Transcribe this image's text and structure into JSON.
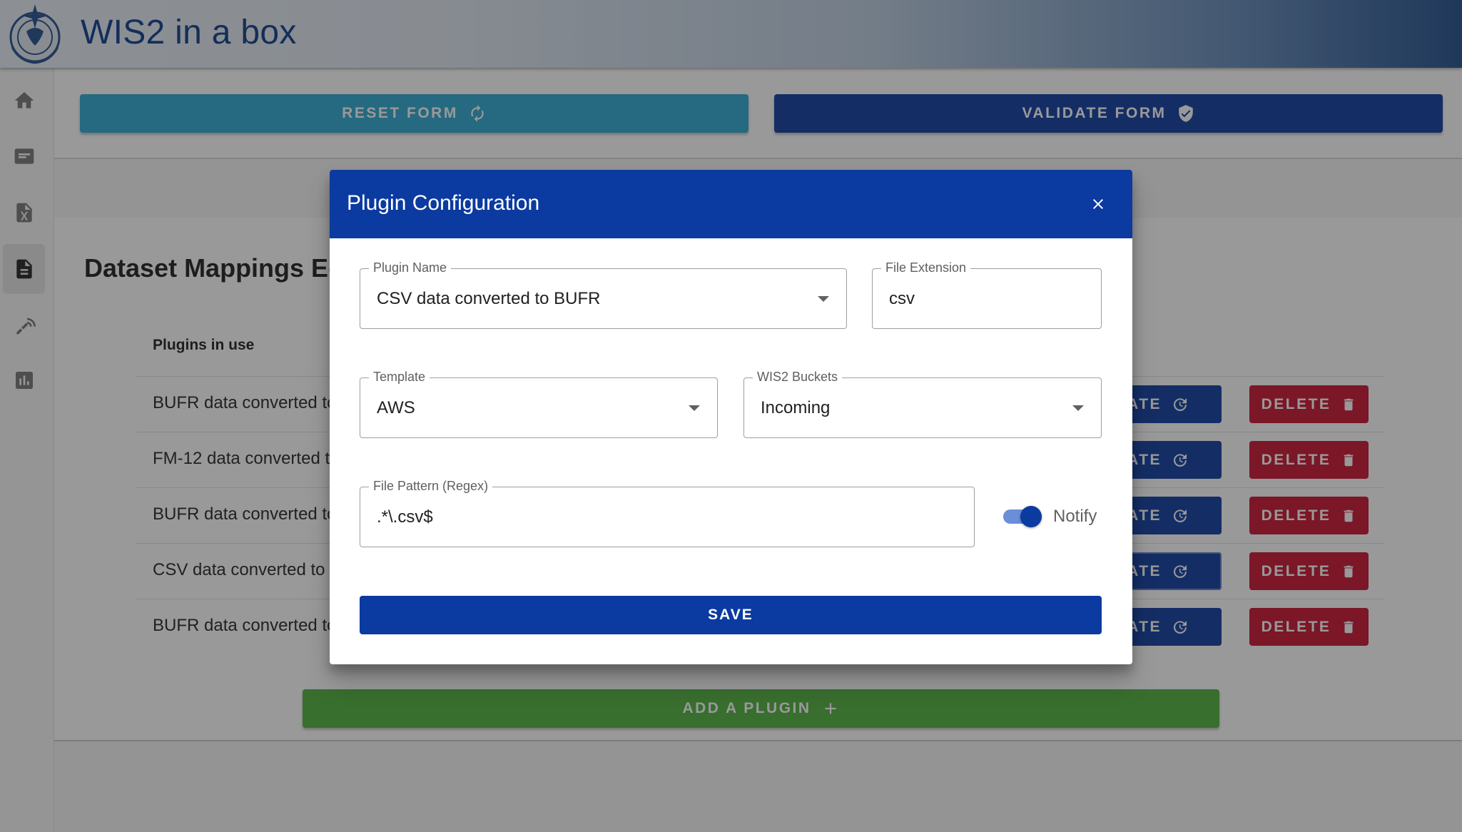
{
  "app": {
    "title": "WIS2 in a box"
  },
  "toolbar": {
    "reset_label": "RESET FORM",
    "validate_label": "VALIDATE FORM"
  },
  "sidebar": {
    "items": [
      {
        "icon": "home-icon"
      },
      {
        "icon": "list-icon"
      },
      {
        "icon": "excel-file-icon"
      },
      {
        "icon": "document-icon",
        "active": true
      },
      {
        "icon": "antenna-icon"
      },
      {
        "icon": "bar-chart-icon"
      }
    ]
  },
  "main": {
    "title": "Dataset Mappings Ed",
    "table_header": "Plugins in use",
    "rows": [
      {
        "label": "BUFR data converted to",
        "update": "PDATE",
        "delete": "DELETE"
      },
      {
        "label": "FM-12 data converted t",
        "update": "PDATE",
        "delete": "DELETE"
      },
      {
        "label": "BUFR data converted to",
        "update": "PDATE",
        "delete": "DELETE"
      },
      {
        "label": "CSV data converted to I",
        "update": "PDATE",
        "delete": "DELETE"
      },
      {
        "label": "BUFR data converted to",
        "update": "PDATE",
        "delete": "DELETE"
      }
    ],
    "add_label": "ADD A PLUGIN"
  },
  "dialog": {
    "title": "Plugin Configuration",
    "plugin_name": {
      "label": "Plugin Name",
      "value": "CSV data converted to BUFR"
    },
    "file_extension": {
      "label": "File Extension",
      "value": "csv"
    },
    "template": {
      "label": "Template",
      "value": "AWS"
    },
    "buckets": {
      "label": "WIS2 Buckets",
      "value": "Incoming"
    },
    "file_pattern": {
      "label": "File Pattern (Regex)",
      "value": ".*\\.csv$"
    },
    "notify": {
      "label": "Notify",
      "on": true
    },
    "save_label": "SAVE"
  },
  "colors": {
    "primary": "#0b3aa0",
    "reset": "#2aa8d1",
    "delete": "#c8102e",
    "add": "#4caf3a"
  }
}
